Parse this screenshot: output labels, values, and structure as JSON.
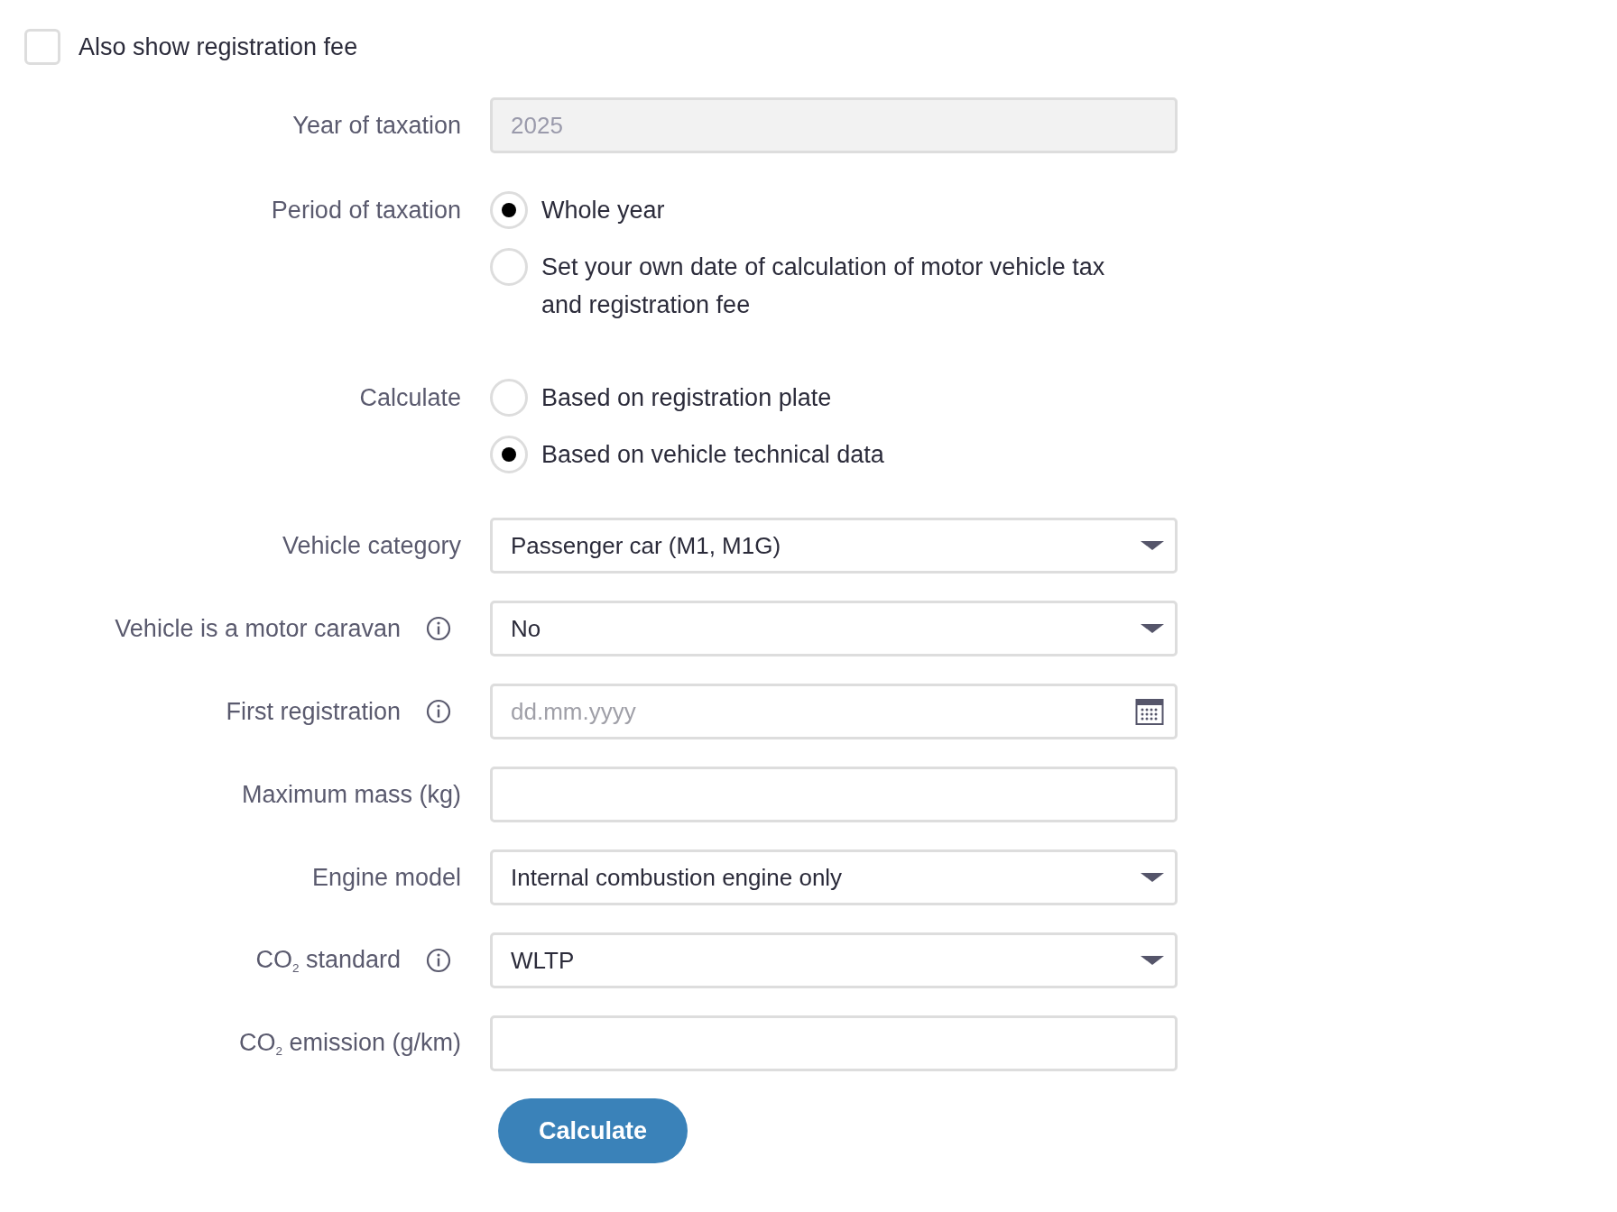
{
  "registration_fee_checkbox": {
    "label": "Also show registration fee",
    "checked": false
  },
  "rows": [
    {
      "kind": "readonly",
      "label": "Year of taxation",
      "info": false,
      "value": "2025"
    },
    {
      "kind": "radio",
      "label": "Period of taxation",
      "info": false,
      "options": [
        {
          "label": "Whole year",
          "selected": true
        },
        {
          "label": "Set your own date of calculation of motor vehicle tax and registration fee",
          "selected": false
        }
      ]
    },
    {
      "kind": "radio",
      "label": "Calculate",
      "info": false,
      "options": [
        {
          "label": "Based on registration plate",
          "selected": false
        },
        {
          "label": "Based on vehicle technical data",
          "selected": true
        }
      ]
    },
    {
      "kind": "select",
      "label": "Vehicle category",
      "info": false,
      "value": "Passenger car (M1, M1G)"
    },
    {
      "kind": "select",
      "label": "Vehicle is a motor caravan",
      "info": true,
      "value": "No"
    },
    {
      "kind": "date",
      "label": "First registration",
      "info": true,
      "placeholder": "dd.mm.yyyy"
    },
    {
      "kind": "text",
      "label": "Maximum mass (kg)",
      "info": false
    },
    {
      "kind": "select",
      "label": "Engine model",
      "info": false,
      "value": "Internal combustion engine only"
    },
    {
      "kind": "select",
      "label": "CO$_{2}$ standard",
      "info": true,
      "value": "WLTP"
    },
    {
      "kind": "text",
      "label": "CO$_{2}$ emission (g/km)",
      "info": false
    }
  ],
  "calculate_button": "Calculate"
}
